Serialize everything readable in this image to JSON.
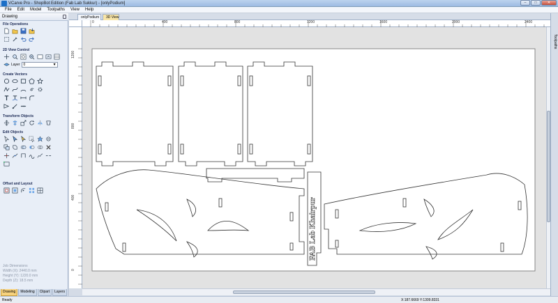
{
  "window": {
    "title": "VCarve Pro - ShopBot Edition (Fab Lab Sukkur) - [onlyPodium]",
    "buttons": {
      "minimize": "–",
      "maximize": "□",
      "close": "✕"
    }
  },
  "menu": [
    "File",
    "Edit",
    "Model",
    "Toolpaths",
    "View",
    "Help"
  ],
  "sidebar": {
    "header": "Drawing",
    "sections": {
      "file_operations": "File Operations",
      "view_control": "2D View Control",
      "create_vectors": "Create Vectors",
      "transform_objects": "Transform Objects",
      "edit_objects": "Edit Objects",
      "offset_layout": "Offset and Layout"
    },
    "layer": {
      "label": "Layer",
      "value": "0"
    },
    "job_dimensions": {
      "heading": "Job Dimensions",
      "width": "Width  (X): 2440.0 mm",
      "height": "Height (Y): 1220.0 mm",
      "depth": "Depth  (Z): 18.5 mm"
    },
    "tabs": [
      "Drawing",
      "Modeling",
      "Clipart",
      "Layers"
    ]
  },
  "doc_tabs": [
    "onlyPodium",
    "3D View"
  ],
  "right_panel": {
    "label": "Toolpaths"
  },
  "ruler": {
    "h_labels": [
      "0",
      "400",
      "800",
      "1200",
      "1600",
      "2000",
      "2400"
    ],
    "v_labels": [
      "1200",
      "800",
      "400",
      "0"
    ]
  },
  "canvas": {
    "engraving_text": "FAB Lab Khairpur"
  },
  "status": {
    "ready": "Ready",
    "coords": "X:187.6669 Y:1309.8331"
  }
}
